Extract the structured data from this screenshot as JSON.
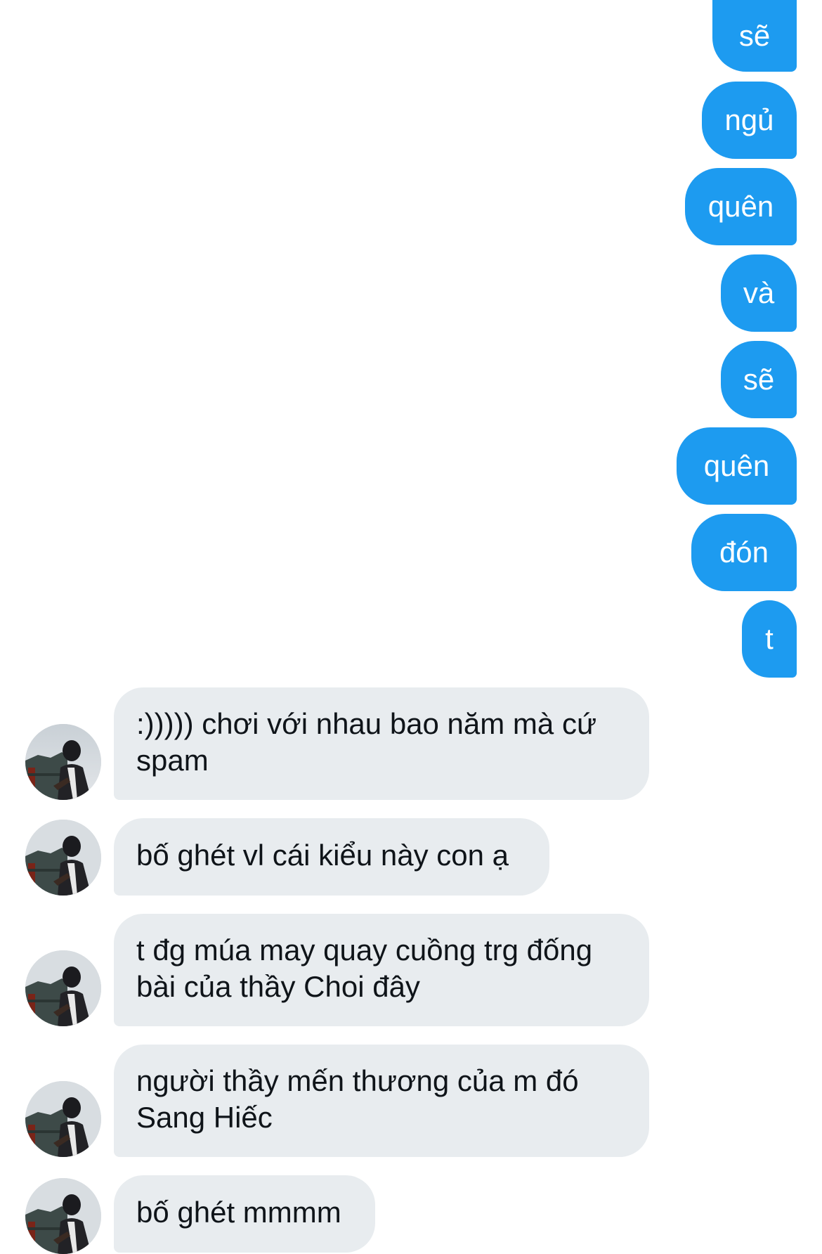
{
  "conversation": {
    "sent_messages": [
      {
        "text": "sẽ"
      },
      {
        "text": "ngủ"
      },
      {
        "text": "quên"
      },
      {
        "text": "và"
      },
      {
        "text": "sẽ"
      },
      {
        "text": "quên"
      },
      {
        "text": "đón"
      },
      {
        "text": "t"
      }
    ],
    "received_messages": [
      {
        "text": ":))))) chơi với nhau bao năm mà cứ spam",
        "avatar": "contact-avatar"
      },
      {
        "text": "bố ghét vl cái kiểu này con ạ",
        "avatar": "contact-avatar"
      },
      {
        "text": "t đg múa may quay cuồng trg đống bài của thầy Choi đây",
        "avatar": "contact-avatar"
      },
      {
        "text": "người thầy mến thương của m đó Sang Hiếc",
        "avatar": "contact-avatar"
      },
      {
        "text": "bố ghét mmmm",
        "avatar": "contact-avatar"
      }
    ]
  },
  "colors": {
    "sent_bubble": "#1d9bf0",
    "received_bubble": "#e8ecef",
    "received_text": "#0f1419",
    "sent_text": "#ffffff"
  }
}
